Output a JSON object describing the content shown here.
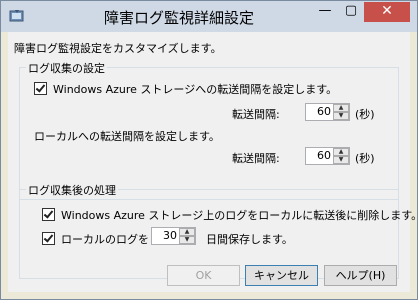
{
  "window": {
    "title": "障害ログ監視詳細設定",
    "min_glyph": "—",
    "max_glyph": "▢",
    "close_glyph": "✕"
  },
  "description": "障害ログ監視設定をカスタマイズします。",
  "collection": {
    "group_label": "ログ収集の設定",
    "azure_transfer_check_label": "Windows Azure ストレージへの転送間隔を設定します。",
    "azure_checked": true,
    "azure_interval_label": "転送間隔:",
    "azure_interval_value": "60",
    "azure_interval_unit": "(秒)",
    "local_transfer_label": "ローカルへの転送間隔を設定します。",
    "local_interval_label": "転送間隔:",
    "local_interval_value": "60",
    "local_interval_unit": "(秒)"
  },
  "post_collection": {
    "group_label": "ログ収集後の処理",
    "delete_after_transfer_label": "Windows Azure ストレージ上のログをローカルに転送後に削除します。",
    "delete_checked": true,
    "local_logs_label": "ローカルのログを",
    "local_checked": true,
    "days_value": "30",
    "days_suffix": "日間保存します。"
  },
  "buttons": {
    "ok": "OK",
    "cancel": "キャンセル",
    "help": "ヘルプ(H)"
  }
}
